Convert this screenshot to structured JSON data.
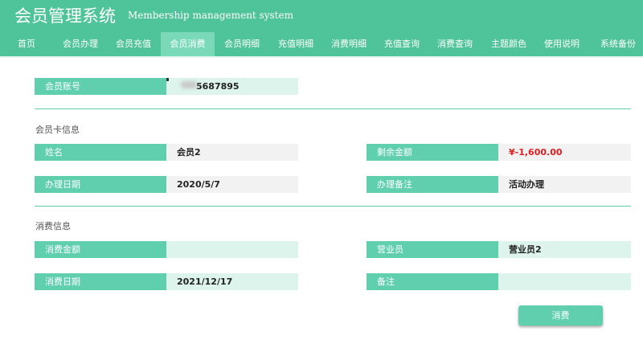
{
  "app": {
    "title": "会员管理系统",
    "subtitle": "Membership management system"
  },
  "nav": {
    "items": [
      {
        "label": "首页"
      },
      {
        "label": "会员办理"
      },
      {
        "label": "会员充值"
      },
      {
        "label": "会员消费",
        "active": true
      },
      {
        "label": "会员明细"
      },
      {
        "label": "充值明细"
      },
      {
        "label": "消费明细"
      },
      {
        "label": "充值查询"
      },
      {
        "label": "消费查询"
      },
      {
        "label": "主题颜色"
      },
      {
        "label": "使用说明"
      },
      {
        "label": "系统备份"
      }
    ]
  },
  "account": {
    "label": "会员账号",
    "value": "5687895"
  },
  "card_info": {
    "section_title": "会员卡信息",
    "name_label": "姓名",
    "name_value": "会员2",
    "balance_label": "剩余金额",
    "balance_value": "¥-1,600.00",
    "date_label": "办理日期",
    "date_value": "2020/5/7",
    "remark_label": "办理备注",
    "remark_value": "活动办理"
  },
  "consume_info": {
    "section_title": "消费信息",
    "amount_label": "消费金额",
    "amount_value": "",
    "clerk_label": "营业员",
    "clerk_value": "营业员2",
    "date_label": "消费日期",
    "date_value": "2021/12/17",
    "remark_label": "备注",
    "remark_value": ""
  },
  "actions": {
    "consume_label": "消费"
  },
  "colors": {
    "accent": "#4fc39a",
    "label_bg": "#5fcfae",
    "negative": "#e02020"
  }
}
